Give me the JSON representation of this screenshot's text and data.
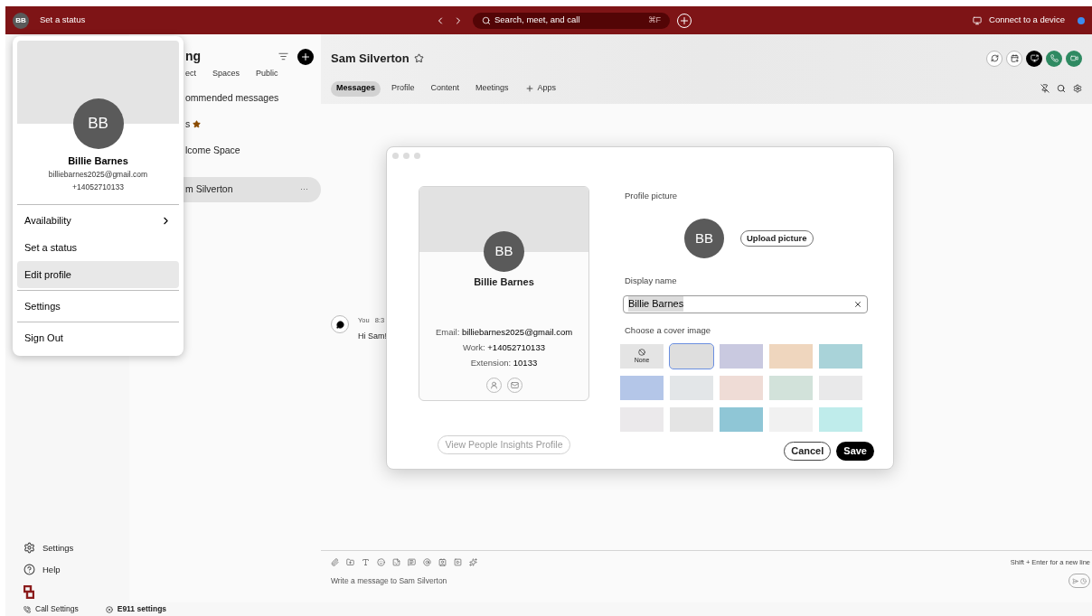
{
  "top_bar": {
    "avatar_initials": "BB",
    "status_link": "Set a status",
    "search_placeholder": "Search, meet, and call",
    "search_shortcut": "⌘F",
    "connect_label": "Connect to a device"
  },
  "profile_menu": {
    "initials": "BB",
    "name": "Billie Barnes",
    "email": "billiebarnes2025@gmail.com",
    "phone": "+14052710133",
    "items": [
      {
        "label": "Availability",
        "kind": "submenu",
        "selected": false,
        "divider_above": true
      },
      {
        "label": "Set a status",
        "kind": "plain",
        "selected": false,
        "divider_above": false
      },
      {
        "label": "Edit profile",
        "kind": "plain",
        "selected": true,
        "divider_above": false
      },
      {
        "label": "Settings",
        "kind": "plain",
        "selected": false,
        "divider_above": true
      },
      {
        "label": "Sign Out",
        "kind": "plain",
        "selected": false,
        "divider_above": true
      }
    ]
  },
  "sidebar": {
    "bottom_items": [
      {
        "label": "Settings",
        "kind": "settings"
      },
      {
        "label": "Help",
        "kind": "help"
      }
    ]
  },
  "footer": {
    "items": [
      {
        "label": "Call Settings",
        "kind": "call"
      },
      {
        "label": "E911 settings",
        "kind": "e911"
      }
    ]
  },
  "list_panel": {
    "title_fragment": "ng",
    "filters": [
      "ect",
      "Spaces",
      "Public"
    ],
    "rows": [
      {
        "label": "ommended messages",
        "kind": "plain",
        "selected": false
      },
      {
        "label": "s",
        "kind": "favorites",
        "selected": false
      },
      {
        "label": "lcome Space",
        "kind": "plain",
        "selected": false
      },
      {
        "label": "m Silverton",
        "kind": "contact",
        "selected": true,
        "more": "···"
      }
    ]
  },
  "conversation": {
    "title": "Sam Silverton",
    "tabs": [
      {
        "label": "Messages",
        "kind": "tab",
        "selected": true
      },
      {
        "label": "Profile",
        "kind": "tab",
        "selected": false
      },
      {
        "label": "Content",
        "kind": "tab",
        "selected": false
      },
      {
        "label": "Meetings",
        "kind": "tab",
        "selected": false
      },
      {
        "label": "Apps",
        "kind": "add",
        "selected": false
      }
    ],
    "message": {
      "author": "You",
      "time": "8:3",
      "text": "Hi Sam!"
    },
    "composer": {
      "placeholder": "Write a message to Sam Silverton",
      "hint": "Shift + Enter for a new line"
    }
  },
  "edit_profile_dialog": {
    "preview": {
      "initials": "BB",
      "name": "Billie Barnes",
      "email_label": "Email:",
      "email": "billiebarnes2025@gmail.com",
      "work_label": "Work:",
      "work": "+14052710133",
      "extension_label": "Extension:",
      "extension": "10133"
    },
    "insights_button": {
      "label": "View People Insights Profile",
      "disabled": true
    },
    "picture_label": "Profile picture",
    "initials": "BB",
    "upload_button": "Upload picture",
    "display_name_label": "Display name",
    "display_name": "Billie Barnes",
    "cover_label": "Choose a cover image",
    "covers": [
      {
        "kind": "none",
        "label": "None",
        "selected": false,
        "color": "#e4e4e4"
      },
      {
        "kind": "image",
        "selected": true,
        "color": "#dedede"
      },
      {
        "kind": "image",
        "selected": false,
        "color": "#c9c9e0"
      },
      {
        "kind": "image",
        "selected": false,
        "color": "#efd6be"
      },
      {
        "kind": "image",
        "selected": false,
        "color": "#a9d3d9"
      },
      {
        "kind": "image",
        "selected": false,
        "color": "#b4c6e8"
      },
      {
        "kind": "image",
        "selected": false,
        "color": "#e3e6e8"
      },
      {
        "kind": "image",
        "selected": false,
        "color": "#efdcd6"
      },
      {
        "kind": "image",
        "selected": false,
        "color": "#d2e2da"
      },
      {
        "kind": "image",
        "selected": false,
        "color": "#e9e9ea"
      },
      {
        "kind": "image",
        "selected": false,
        "color": "#ebe9eb"
      },
      {
        "kind": "image",
        "selected": false,
        "color": "#e4e4e4"
      },
      {
        "kind": "image",
        "selected": false,
        "color": "#8fc6d6"
      },
      {
        "kind": "image",
        "selected": false,
        "color": "#f1f1f1"
      },
      {
        "kind": "image",
        "selected": false,
        "color": "#bfeceb"
      }
    ],
    "cancel": "Cancel",
    "save": "Save"
  }
}
